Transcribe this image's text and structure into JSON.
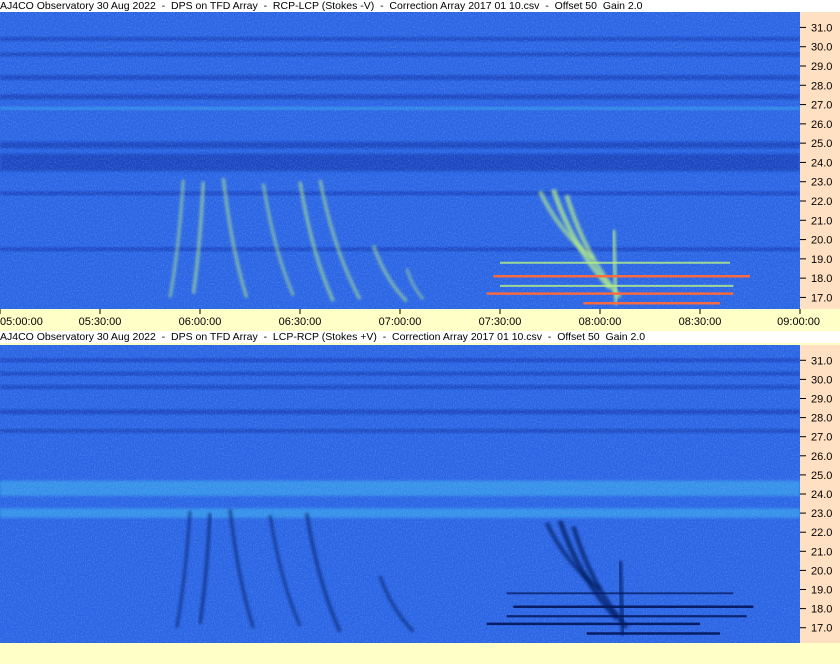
{
  "colors": {
    "background": "#ffffc8",
    "freq_axis_panel": "#ffe0c2",
    "title_bar": "#ffffff",
    "spectrogram_base": "#2a64e4",
    "upper_band_dark": "#0d2fa6",
    "lower_band_light": "#3aa8ee",
    "burst_bright": "#b8f08a",
    "burst_dark": "#051a60",
    "hot_line": "#ff6a3a"
  },
  "chart_data": [
    {
      "type": "heatmap",
      "title": "AJ4CO Observatory 30 Aug 2022  -  DPS on TFD Array  -  RCP-LCP (Stokes -V)  -  Correction Array 2017 01 10.csv  -  Offset 50  Gain 2.0",
      "xlabel": "",
      "ylabel": "",
      "x_ticks": [
        "05:00:00",
        "05:30:00",
        "06:00:00",
        "06:30:00",
        "07:00:00",
        "07:30:00",
        "08:00:00",
        "08:30:00",
        "09:00:00"
      ],
      "y_ticks": [
        "31.0",
        "30.0",
        "29.0",
        "28.0",
        "27.0",
        "26.0",
        "25.0",
        "24.0",
        "23.0",
        "22.0",
        "21.0",
        "20.0",
        "19.0",
        "18.0",
        "17.0"
      ],
      "xlim": [
        "05:00:00",
        "09:00:00"
      ],
      "ylim": [
        16.4,
        31.8
      ],
      "polarity": "bright",
      "bands": [
        {
          "freq_center": 24.0,
          "width": 0.9,
          "kind": "dark"
        },
        {
          "freq_center": 24.9,
          "width": 0.35,
          "kind": "dark"
        },
        {
          "freq_center": 30.4,
          "width": 0.2,
          "kind": "dark"
        },
        {
          "freq_center": 29.6,
          "width": 0.2,
          "kind": "dark"
        },
        {
          "freq_center": 28.4,
          "width": 0.25,
          "kind": "dark"
        },
        {
          "freq_center": 26.8,
          "width": 0.15,
          "kind": "light"
        },
        {
          "freq_center": 27.4,
          "width": 0.25,
          "kind": "dark"
        },
        {
          "freq_center": 22.4,
          "width": 0.2,
          "kind": "dark"
        },
        {
          "freq_center": 19.5,
          "width": 0.2,
          "kind": "dark"
        }
      ],
      "bursts": [
        {
          "t_start": "05:55:00",
          "f_start": 23.1,
          "t_end": "05:51:00",
          "f_end": 17.0,
          "strength": 0.5
        },
        {
          "t_start": "06:01:00",
          "f_start": 23.0,
          "t_end": "05:58:00",
          "f_end": 17.2,
          "strength": 0.6
        },
        {
          "t_start": "06:07:00",
          "f_start": 23.2,
          "t_end": "06:14:00",
          "f_end": 17.0,
          "strength": 0.55
        },
        {
          "t_start": "06:19:00",
          "f_start": 22.9,
          "t_end": "06:28:00",
          "f_end": 17.1,
          "strength": 0.5
        },
        {
          "t_start": "06:30:00",
          "f_start": 23.0,
          "t_end": "06:40:00",
          "f_end": 16.8,
          "strength": 0.6
        },
        {
          "t_start": "06:36:00",
          "f_start": 23.1,
          "t_end": "06:48:00",
          "f_end": 16.9,
          "strength": 0.55
        },
        {
          "t_start": "06:52:00",
          "f_start": 19.7,
          "t_end": "07:02:00",
          "f_end": 16.8,
          "strength": 0.55
        },
        {
          "t_start": "07:02:00",
          "f_start": 18.5,
          "t_end": "07:07:00",
          "f_end": 16.9,
          "strength": 0.4
        },
        {
          "t_start": "07:42:00",
          "f_start": 22.5,
          "t_end": "07:58:00",
          "f_end": 19.0,
          "strength": 0.8
        },
        {
          "t_start": "07:46:00",
          "f_start": 22.6,
          "t_end": "08:03:00",
          "f_end": 17.5,
          "strength": 1.0
        },
        {
          "t_start": "07:50:00",
          "f_start": 22.3,
          "t_end": "08:06:00",
          "f_end": 17.0,
          "strength": 0.9
        },
        {
          "t_start": "08:04:00",
          "f_start": 20.5,
          "t_end": "08:05:00",
          "f_end": 16.6,
          "strength": 0.9
        }
      ],
      "lines": [
        {
          "t_start": "07:30:00",
          "t_end": "08:39:00",
          "freq": 18.8,
          "strength": 0.7
        },
        {
          "t_start": "07:28:00",
          "t_end": "08:45:00",
          "freq": 18.1,
          "strength": 1.0
        },
        {
          "t_start": "07:30:00",
          "t_end": "08:40:00",
          "freq": 17.6,
          "strength": 0.7
        },
        {
          "t_start": "07:26:00",
          "t_end": "08:40:00",
          "freq": 17.2,
          "strength": 1.0
        },
        {
          "t_start": "07:55:00",
          "t_end": "08:36:00",
          "freq": 16.7,
          "strength": 1.0
        }
      ]
    },
    {
      "type": "heatmap",
      "title": "AJ4CO Observatory 30 Aug 2022  -  DPS on TFD Array  -  LCP-RCP (Stokes +V)  -  Correction Array 2017 01 10.csv  -  Offset 50  Gain 2.0",
      "xlabel": "",
      "ylabel": "",
      "x_ticks": [],
      "y_ticks": [
        "31.0",
        "30.0",
        "29.0",
        "28.0",
        "27.0",
        "26.0",
        "25.0",
        "24.0",
        "23.0",
        "22.0",
        "21.0",
        "20.0",
        "19.0",
        "18.0",
        "17.0"
      ],
      "xlim": [
        "05:00:00",
        "09:00:00"
      ],
      "ylim": [
        16.2,
        31.8
      ],
      "polarity": "dark",
      "bands": [
        {
          "freq_center": 24.3,
          "width": 0.8,
          "kind": "light"
        },
        {
          "freq_center": 23.0,
          "width": 0.5,
          "kind": "light"
        },
        {
          "freq_center": 31.0,
          "width": 0.2,
          "kind": "dark"
        },
        {
          "freq_center": 30.3,
          "width": 0.2,
          "kind": "dark"
        },
        {
          "freq_center": 29.6,
          "width": 0.2,
          "kind": "dark"
        },
        {
          "freq_center": 28.3,
          "width": 0.25,
          "kind": "dark"
        },
        {
          "freq_center": 27.3,
          "width": 0.2,
          "kind": "dark"
        }
      ],
      "bursts": [
        {
          "t_start": "05:57:00",
          "f_start": 23.1,
          "t_end": "05:53:00",
          "f_end": 17.0,
          "strength": 0.5
        },
        {
          "t_start": "06:03:00",
          "f_start": 23.0,
          "t_end": "06:00:00",
          "f_end": 17.2,
          "strength": 0.6
        },
        {
          "t_start": "06:09:00",
          "f_start": 23.2,
          "t_end": "06:16:00",
          "f_end": 17.0,
          "strength": 0.55
        },
        {
          "t_start": "06:21:00",
          "f_start": 22.9,
          "t_end": "06:30:00",
          "f_end": 17.1,
          "strength": 0.5
        },
        {
          "t_start": "06:32:00",
          "f_start": 23.0,
          "t_end": "06:42:00",
          "f_end": 16.8,
          "strength": 0.6
        },
        {
          "t_start": "06:54:00",
          "f_start": 19.7,
          "t_end": "07:04:00",
          "f_end": 16.8,
          "strength": 0.55
        },
        {
          "t_start": "07:44:00",
          "f_start": 22.5,
          "t_end": "08:00:00",
          "f_end": 19.0,
          "strength": 0.8
        },
        {
          "t_start": "07:48:00",
          "f_start": 22.6,
          "t_end": "08:05:00",
          "f_end": 17.5,
          "strength": 1.0
        },
        {
          "t_start": "07:52:00",
          "f_start": 22.3,
          "t_end": "08:08:00",
          "f_end": 17.0,
          "strength": 0.9
        },
        {
          "t_start": "08:06:00",
          "f_start": 20.5,
          "t_end": "08:07:00",
          "f_end": 16.6,
          "strength": 0.9
        }
      ],
      "lines": [
        {
          "t_start": "07:32:00",
          "t_end": "08:40:00",
          "freq": 18.8,
          "strength": 0.6
        },
        {
          "t_start": "07:34:00",
          "t_end": "08:46:00",
          "freq": 18.1,
          "strength": 1.0
        },
        {
          "t_start": "07:32:00",
          "t_end": "08:44:00",
          "freq": 17.6,
          "strength": 0.8
        },
        {
          "t_start": "07:26:00",
          "t_end": "08:30:00",
          "freq": 17.2,
          "strength": 1.0
        },
        {
          "t_start": "07:56:00",
          "t_end": "08:36:00",
          "freq": 16.7,
          "strength": 1.0
        }
      ]
    }
  ]
}
